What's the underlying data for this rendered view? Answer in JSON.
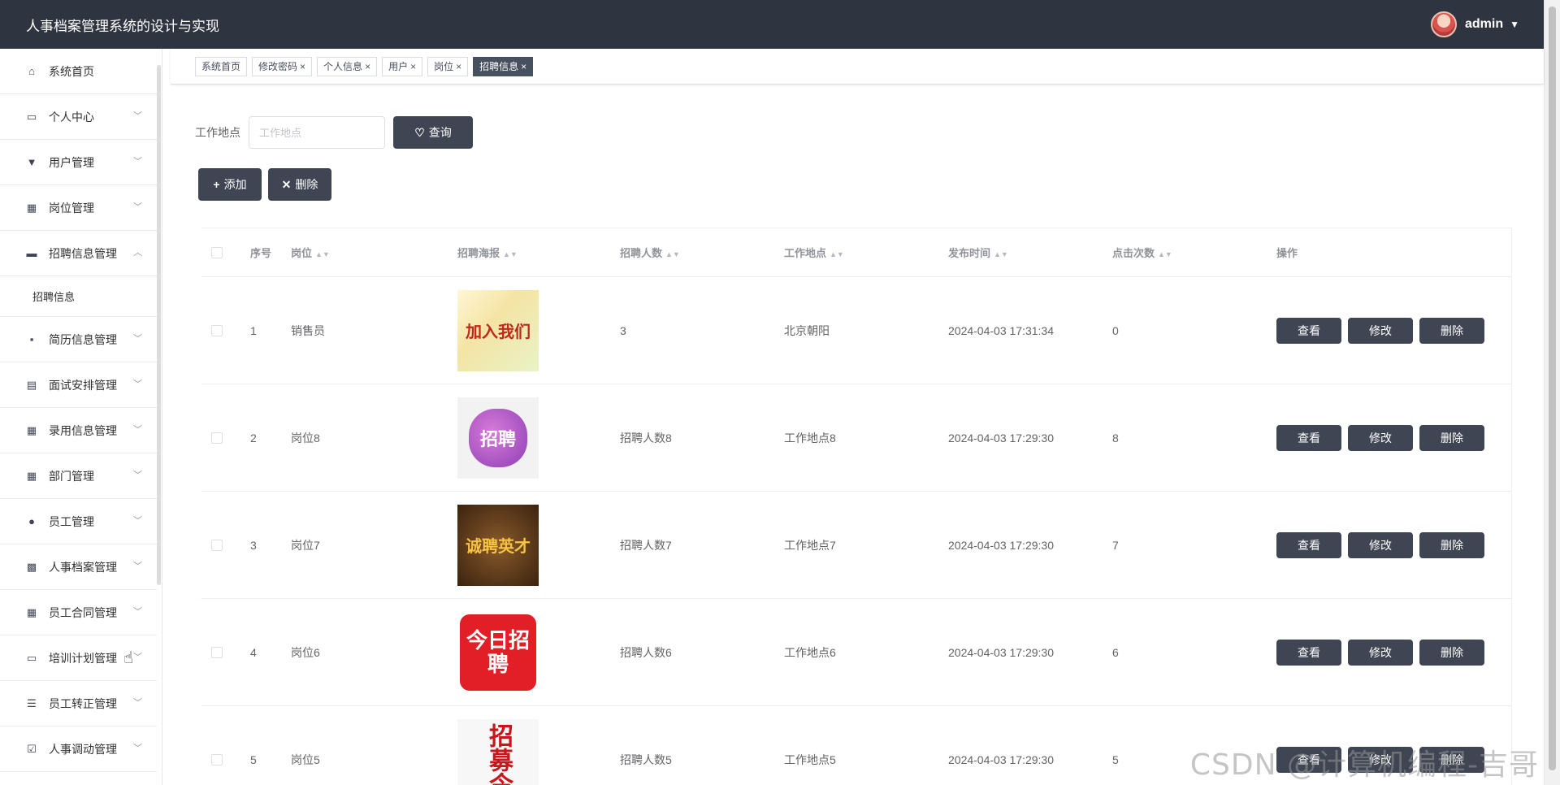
{
  "header": {
    "title": "人事档案管理系统的设计与实现",
    "user": "admin"
  },
  "sidebar": {
    "items": [
      {
        "label": "系统首页",
        "icon": "home-icon"
      },
      {
        "label": "个人中心",
        "icon": "card-icon"
      },
      {
        "label": "用户管理",
        "icon": "user-icon"
      },
      {
        "label": "岗位管理",
        "icon": "grid-icon"
      },
      {
        "label": "招聘信息管理",
        "icon": "briefcase-icon"
      },
      {
        "label": "简历信息管理",
        "icon": "chat-icon"
      },
      {
        "label": "面试安排管理",
        "icon": "clipboard-icon"
      },
      {
        "label": "录用信息管理",
        "icon": "grid-icon"
      },
      {
        "label": "部门管理",
        "icon": "grid-icon"
      },
      {
        "label": "员工管理",
        "icon": "bulb-icon"
      },
      {
        "label": "人事档案管理",
        "icon": "apps-icon"
      },
      {
        "label": "员工合同管理",
        "icon": "grid-icon"
      },
      {
        "label": "培训计划管理",
        "icon": "monitor-icon"
      },
      {
        "label": "员工转正管理",
        "icon": "list-icon"
      },
      {
        "label": "人事调动管理",
        "icon": "check-icon"
      }
    ],
    "submenu": {
      "label": "招聘信息"
    }
  },
  "tabs": [
    {
      "label": "系统首页"
    },
    {
      "label": "修改密码"
    },
    {
      "label": "个人信息"
    },
    {
      "label": "用户"
    },
    {
      "label": "岗位"
    },
    {
      "label": "招聘信息"
    }
  ],
  "search": {
    "label": "工作地点",
    "placeholder": "工作地点",
    "button": "查询"
  },
  "actions": {
    "add": "添加",
    "delete": "删除"
  },
  "table": {
    "headers": {
      "index": "序号",
      "position": "岗位",
      "poster": "招聘海报",
      "count": "招聘人数",
      "location": "工作地点",
      "time": "发布时间",
      "clicks": "点击次数",
      "ops": "操作"
    },
    "op_labels": {
      "view": "查看",
      "edit": "修改",
      "delete": "删除"
    },
    "rows": [
      {
        "index": "1",
        "position": "销售员",
        "poster_text": "加入我们",
        "count": "3",
        "location": "北京朝阳",
        "time": "2024-04-03 17:31:34",
        "clicks": "0"
      },
      {
        "index": "2",
        "position": "岗位8",
        "poster_text": "招聘",
        "count": "招聘人数8",
        "location": "工作地点8",
        "time": "2024-04-03 17:29:30",
        "clicks": "8"
      },
      {
        "index": "3",
        "position": "岗位7",
        "poster_text": "诚聘英才",
        "count": "招聘人数7",
        "location": "工作地点7",
        "time": "2024-04-03 17:29:30",
        "clicks": "7"
      },
      {
        "index": "4",
        "position": "岗位6",
        "poster_text": "今日招聘",
        "count": "招聘人数6",
        "location": "工作地点6",
        "time": "2024-04-03 17:29:30",
        "clicks": "6"
      },
      {
        "index": "5",
        "position": "岗位5",
        "poster_text": "招募令",
        "count": "招聘人数5",
        "location": "工作地点5",
        "time": "2024-04-03 17:29:30",
        "clicks": "5"
      }
    ]
  },
  "watermark": "CSDN @计算机编程-吉哥",
  "colors": {
    "topbar": "#2f3540",
    "button": "#3f4552",
    "active_tab": "#47505e"
  }
}
